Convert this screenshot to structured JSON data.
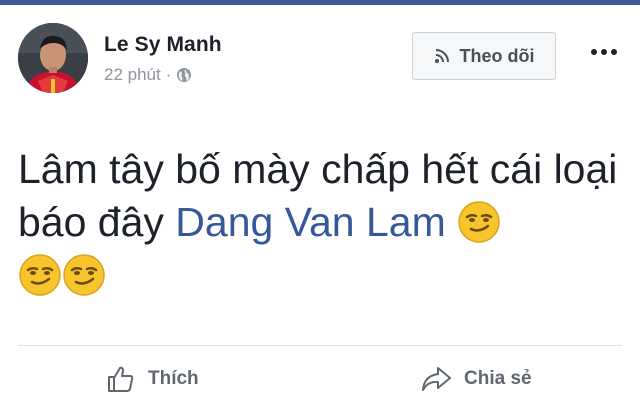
{
  "post": {
    "author": "Le Sy Manh",
    "time": "22 phút",
    "separator": "·",
    "follow_label": "Theo dõi",
    "text_part1": "Lâm tây bố mày chấp hết cái loại báo đây ",
    "mention": "Dang Van Lam",
    "emojis": [
      "smirk-emoji",
      "smirk-emoji",
      "smirk-emoji"
    ]
  },
  "actions": {
    "like_label": "Thích",
    "share_label": "Chia sẻ"
  },
  "colors": {
    "accent": "#3b5998",
    "mention": "#365899",
    "text": "#1d2129",
    "muted": "#90949c"
  },
  "icons": [
    "globe-icon",
    "rss-icon",
    "more-dots-icon",
    "thumbs-up-icon",
    "share-arrow-icon"
  ]
}
